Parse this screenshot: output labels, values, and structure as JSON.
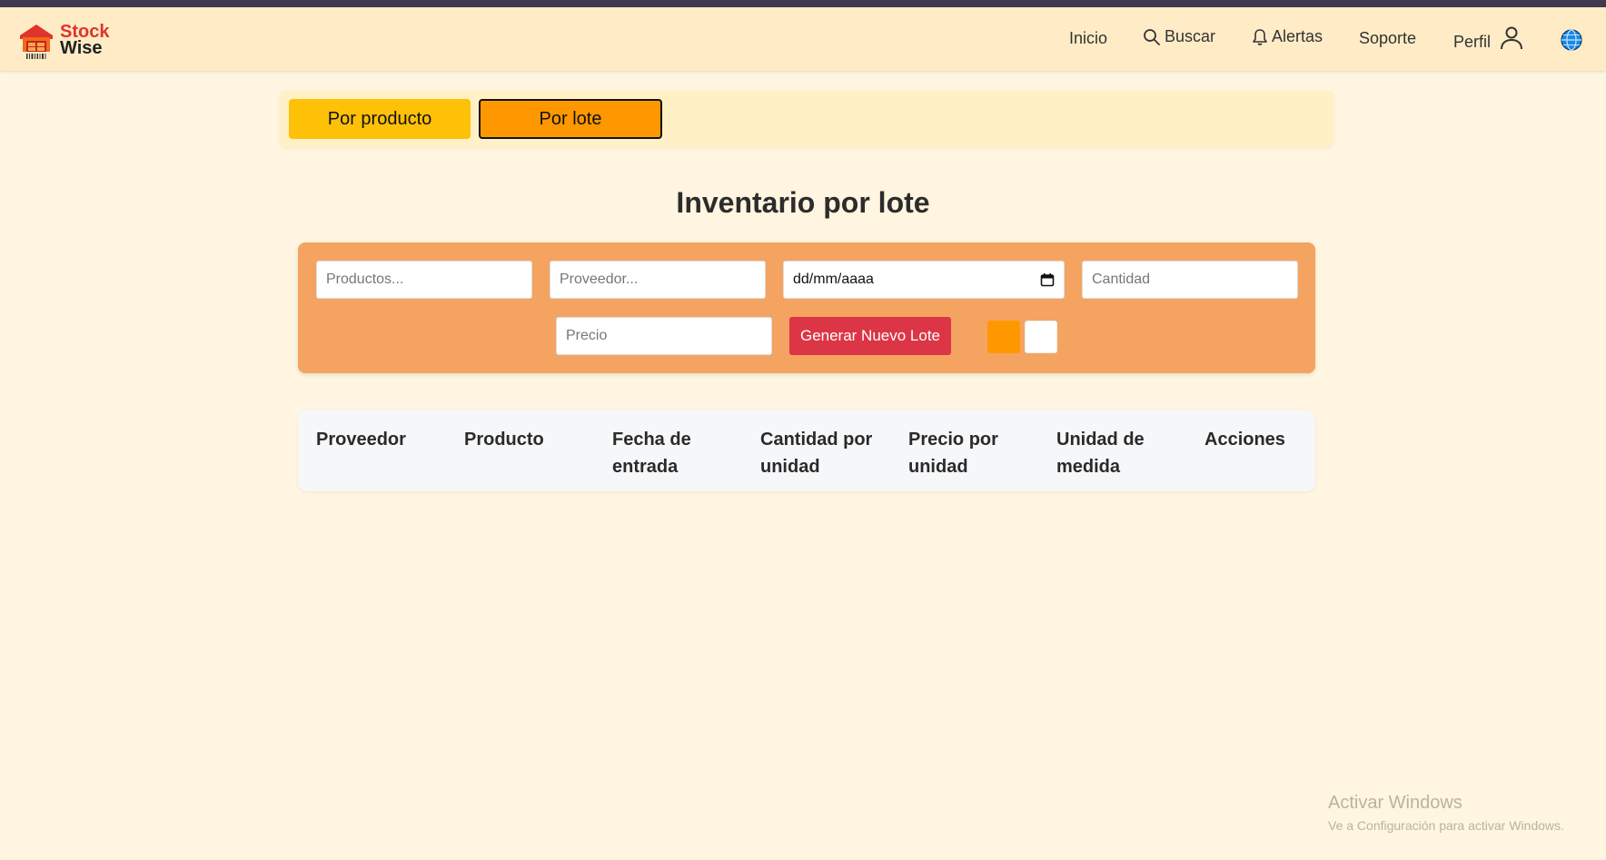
{
  "navbar": {
    "logo_line1": "Stock",
    "logo_line2": "Wise",
    "links": {
      "inicio": "Inicio",
      "buscar": "Buscar",
      "alertas": "Alertas",
      "soporte": "Soporte",
      "perfil": "Perfil"
    },
    "icons": [
      "search-icon",
      "bell-icon",
      "user-icon",
      "globe-icon"
    ]
  },
  "tabs": {
    "por_producto": "Por producto",
    "por_lote": "Por lote",
    "active": "Por lote"
  },
  "page": {
    "title": "Inventario por lote"
  },
  "form": {
    "productos_placeholder": "Productos...",
    "proveedor_placeholder": "Proveedor...",
    "fecha_placeholder": "dd/mm/aaaa",
    "cantidad_placeholder": "Cantidad",
    "precio_placeholder": "Precio",
    "generate_button": "Generar Nuevo Lote"
  },
  "table": {
    "headers": [
      "Proveedor",
      "Producto",
      "Fecha de entrada",
      "Cantidad por unidad",
      "Precio por unidad",
      "Unidad de medida",
      "Acciones"
    ],
    "rows": []
  },
  "watermark": {
    "line1": "Activar Windows",
    "line2": "Ve a Configuración para activar Windows."
  },
  "colors": {
    "background": "#fff5e0",
    "navbar": "#ffecc6",
    "tab_product": "#ffc107",
    "tab_lote": "#ff9800",
    "form_card": "#f4a460",
    "generate_button": "#dc3545",
    "swatch_orange": "#ff9800",
    "swatch_white": "#ffffff"
  }
}
